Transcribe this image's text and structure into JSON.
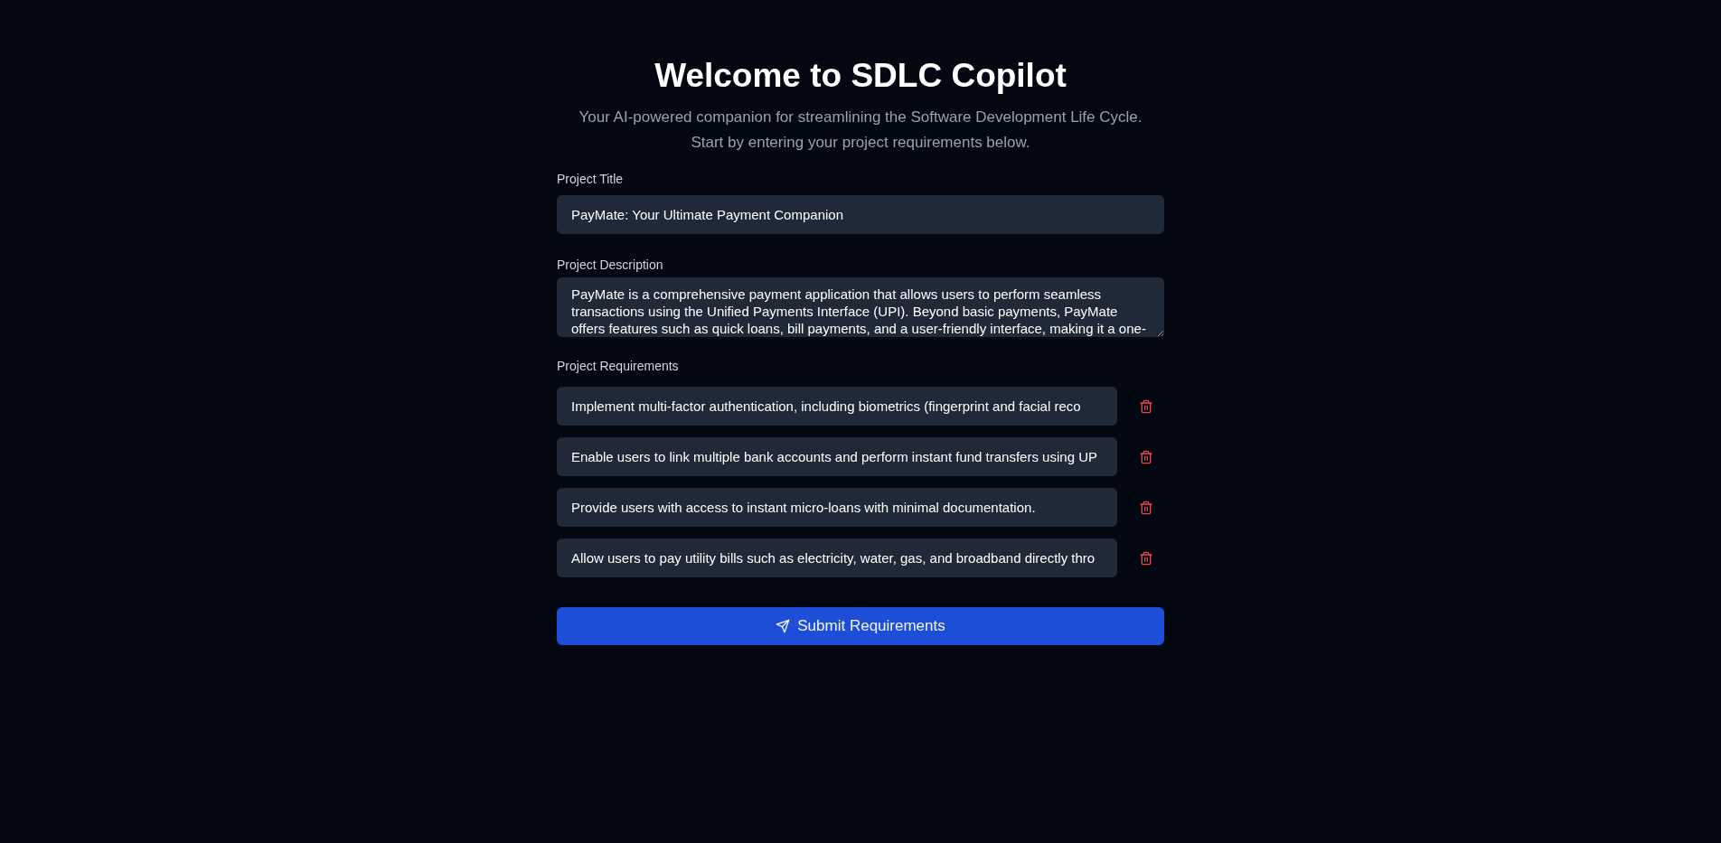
{
  "header": {
    "title": "Welcome to SDLC Copilot",
    "subtitle": "Your AI-powered companion for streamlining the Software Development Life Cycle. Start by entering your project requirements below."
  },
  "fields": [
    {
      "kind": "input",
      "label": "Project Title",
      "value": "PayMate: Your Ultimate Payment Companion"
    },
    {
      "kind": "textarea",
      "label": "Project Description",
      "value": "PayMate is a comprehensive payment application that allows users to perform seamless transactions using the Unified Payments Interface (UPI). Beyond basic payments, PayMate offers features such as quick loans, bill payments, and a user-friendly interface, making it a one-"
    }
  ],
  "requirements": {
    "label": "Project Requirements",
    "items": [
      {
        "value": "Implement multi-factor authentication, including biometrics (fingerprint and facial reco"
      },
      {
        "value": "Enable users to link multiple bank accounts and perform instant fund transfers using UP"
      },
      {
        "value": "Provide users with access to instant micro-loans with minimal documentation."
      },
      {
        "value": "Allow users to pay utility bills such as electricity, water, gas, and broadband directly thro"
      }
    ]
  },
  "submit_button": {
    "label": "Submit Requirements"
  }
}
